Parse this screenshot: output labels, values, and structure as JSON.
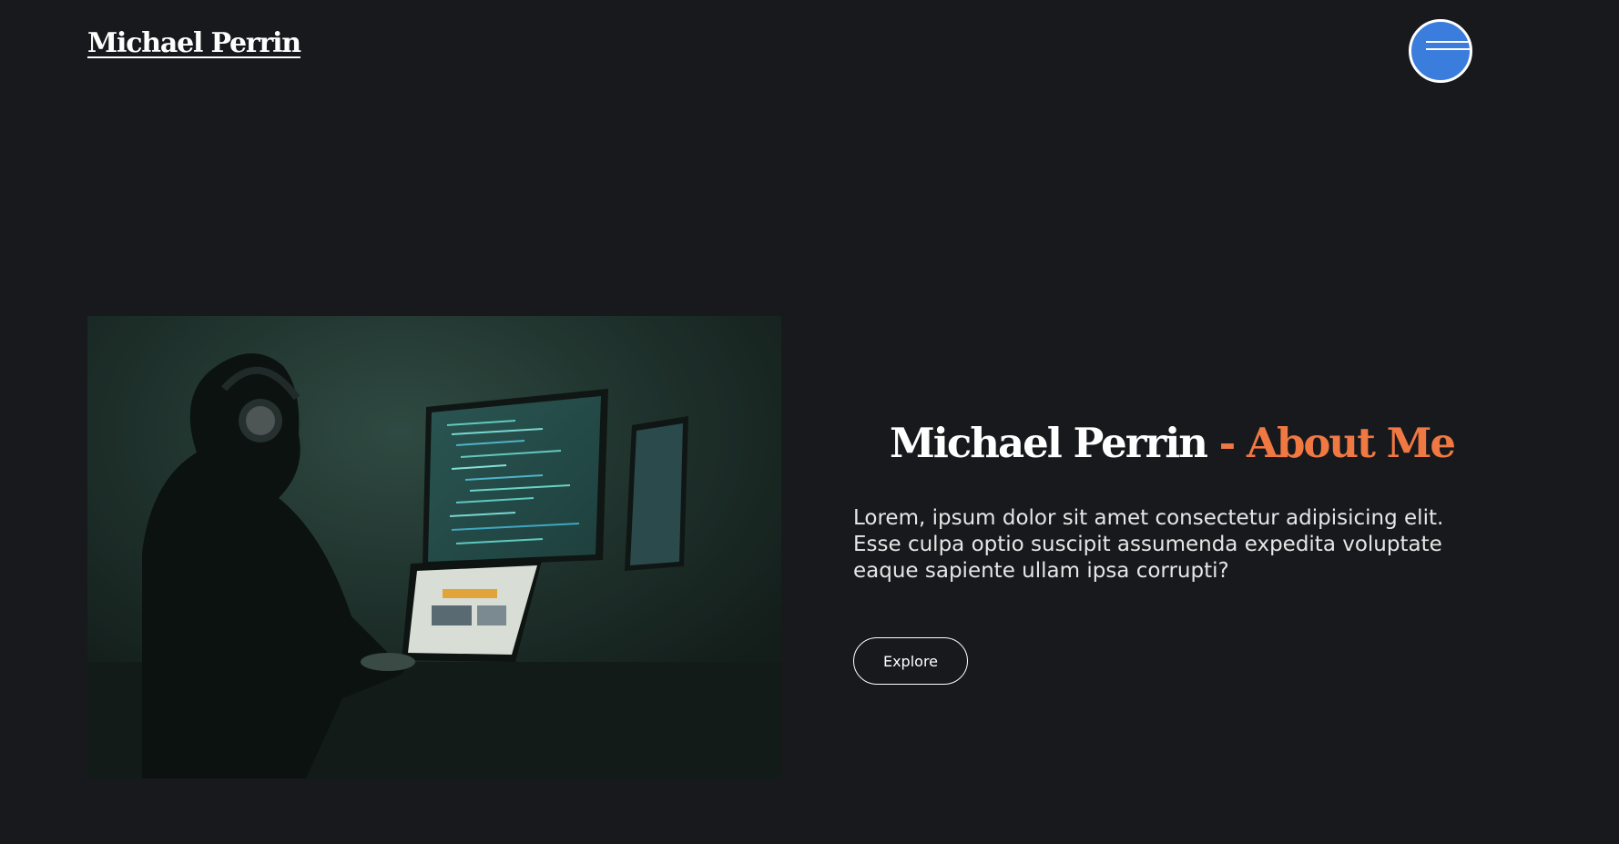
{
  "header": {
    "logo_text": "Michael Perrin",
    "menu_icon": "hamburger-menu-icon"
  },
  "hero": {
    "image_description_icon": "developer-at-desk-photo",
    "title_name": "Michael Perrin",
    "title_separator": " - ",
    "title_accent": "About Me",
    "description": "Lorem, ipsum dolor sit amet consectetur adipisicing elit. Esse culpa optio suscipit assumenda expedita voluptate eaque sapiente ullam ipsa corrupti?",
    "button_label": "Explore"
  },
  "colors": {
    "background": "#17191c",
    "accent": "#f07843",
    "menu_button": "#3b7ddd"
  }
}
